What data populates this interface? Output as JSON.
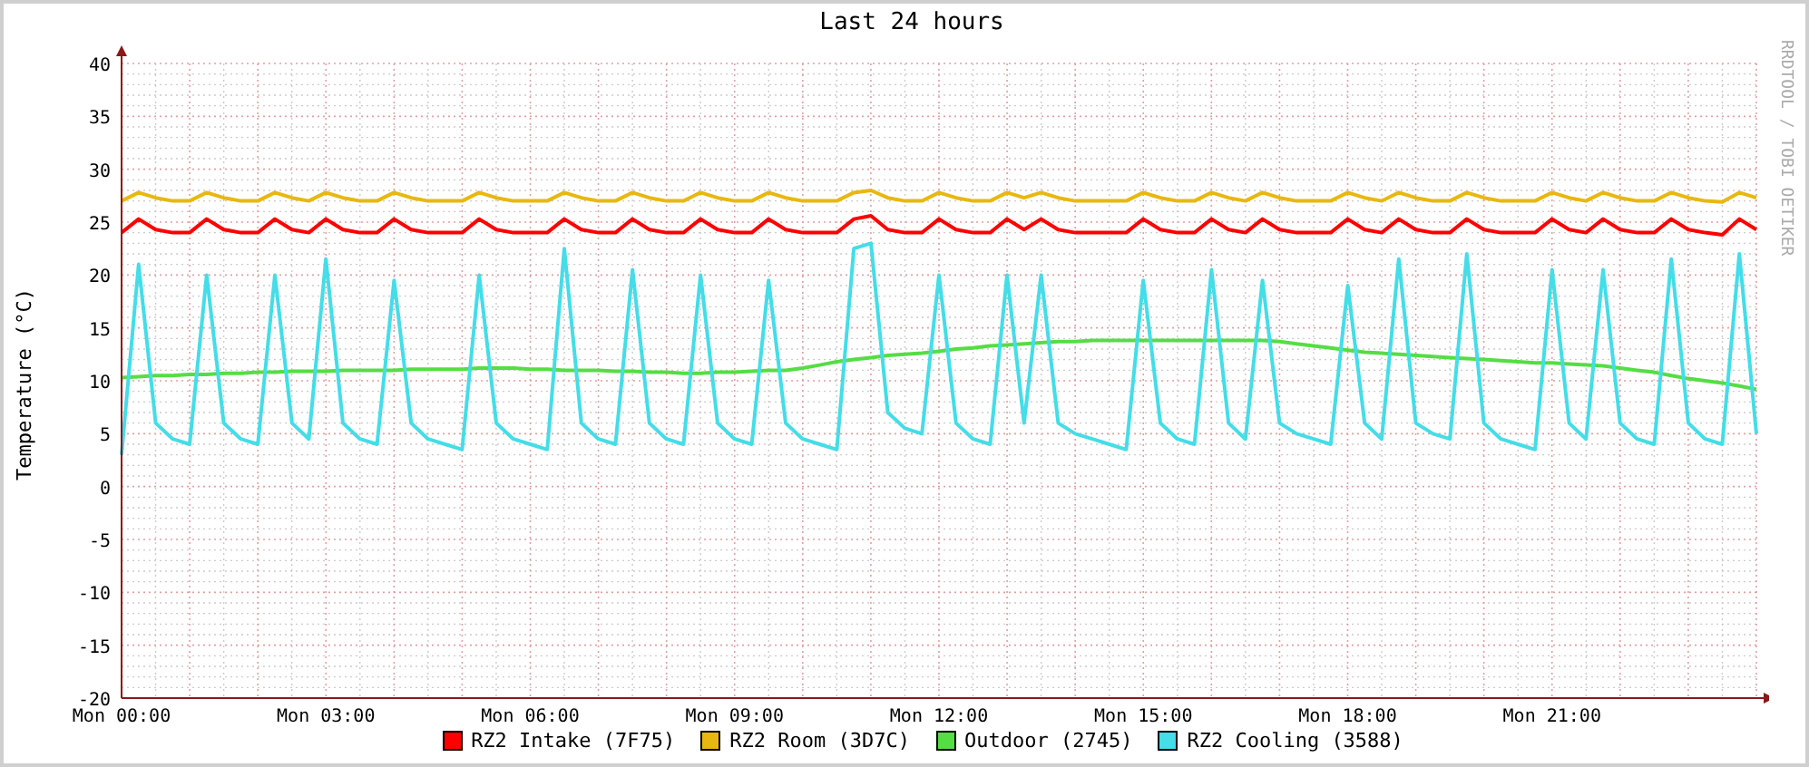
{
  "graph": {
    "credit": "RRDTOOL / TOBI OETIKER",
    "chart_data": {
      "type": "line",
      "title": "Last 24 hours",
      "ylabel": "Temperature (°C)",
      "ylim": [
        -20,
        40
      ],
      "grid": true,
      "yticks": [
        -20,
        -15,
        -10,
        -5,
        0,
        5,
        10,
        15,
        20,
        25,
        30,
        35,
        40
      ],
      "categories": [
        "Mon 00:00",
        null,
        null,
        null,
        null,
        null,
        null,
        null,
        null,
        null,
        null,
        null,
        "Mon 03:00",
        null,
        null,
        null,
        null,
        null,
        null,
        null,
        null,
        null,
        null,
        null,
        "Mon 06:00",
        null,
        null,
        null,
        null,
        null,
        null,
        null,
        null,
        null,
        null,
        null,
        "Mon 09:00",
        null,
        null,
        null,
        null,
        null,
        null,
        null,
        null,
        null,
        null,
        null,
        "Mon 12:00",
        null,
        null,
        null,
        null,
        null,
        null,
        null,
        null,
        null,
        null,
        null,
        "Mon 15:00",
        null,
        null,
        null,
        null,
        null,
        null,
        null,
        null,
        null,
        null,
        null,
        "Mon 18:00",
        null,
        null,
        null,
        null,
        null,
        null,
        null,
        null,
        null,
        null,
        null,
        "Mon 21:00",
        null,
        null,
        null,
        null,
        null,
        null,
        null,
        null,
        null,
        null,
        null,
        null
      ],
      "series": [
        {
          "name": "RZ2 Intake (7F75)",
          "color": "#ff0000",
          "values": [
            24,
            25.3,
            24.3,
            24,
            24,
            25.3,
            24.3,
            24,
            24,
            25.3,
            24.3,
            24,
            25.3,
            24.3,
            24,
            24,
            25.3,
            24.3,
            24,
            24,
            24,
            25.3,
            24.3,
            24,
            24,
            24,
            25.3,
            24.3,
            24,
            24,
            25.3,
            24.3,
            24,
            24,
            25.3,
            24.3,
            24,
            24,
            25.3,
            24.3,
            24,
            24,
            24,
            25.3,
            25.6,
            24.3,
            24,
            24,
            25.3,
            24.3,
            24,
            24,
            25.3,
            24.3,
            25.3,
            24.3,
            24,
            24,
            24,
            24,
            25.3,
            24.3,
            24,
            24,
            25.3,
            24.3,
            24,
            25.3,
            24.3,
            24,
            24,
            24,
            25.3,
            24.3,
            24,
            25.3,
            24.3,
            24,
            24,
            25.3,
            24.3,
            24,
            24,
            24,
            25.3,
            24.3,
            24,
            25.3,
            24.3,
            24,
            24,
            25.3,
            24.3,
            24,
            23.8,
            25.3,
            24.3
          ]
        },
        {
          "name": "RZ2 Room (3D7C)",
          "color": "#e8b810",
          "values": [
            27,
            27.8,
            27.3,
            27,
            27,
            27.8,
            27.3,
            27,
            27,
            27.8,
            27.3,
            27,
            27.8,
            27.3,
            27,
            27,
            27.8,
            27.3,
            27,
            27,
            27,
            27.8,
            27.3,
            27,
            27,
            27,
            27.8,
            27.3,
            27,
            27,
            27.8,
            27.3,
            27,
            27,
            27.8,
            27.3,
            27,
            27,
            27.8,
            27.3,
            27,
            27,
            27,
            27.8,
            28,
            27.3,
            27,
            27,
            27.8,
            27.3,
            27,
            27,
            27.8,
            27.3,
            27.8,
            27.3,
            27,
            27,
            27,
            27,
            27.8,
            27.3,
            27,
            27,
            27.8,
            27.3,
            27,
            27.8,
            27.3,
            27,
            27,
            27,
            27.8,
            27.3,
            27,
            27.8,
            27.3,
            27,
            27,
            27.8,
            27.3,
            27,
            27,
            27,
            27.8,
            27.3,
            27,
            27.8,
            27.3,
            27,
            27,
            27.8,
            27.3,
            27,
            26.9,
            27.8,
            27.3
          ]
        },
        {
          "name": "Outdoor (2745)",
          "color": "#55dd44",
          "values": [
            10.3,
            10.4,
            10.5,
            10.5,
            10.6,
            10.6,
            10.7,
            10.7,
            10.8,
            10.8,
            10.9,
            10.9,
            10.9,
            11,
            11,
            11,
            11,
            11.1,
            11.1,
            11.1,
            11.1,
            11.2,
            11.2,
            11.2,
            11.1,
            11.1,
            11,
            11,
            11,
            10.9,
            10.9,
            10.8,
            10.8,
            10.7,
            10.7,
            10.8,
            10.8,
            10.9,
            11,
            11,
            11.2,
            11.5,
            11.8,
            12,
            12.2,
            12.4,
            12.5,
            12.6,
            12.8,
            13,
            13.1,
            13.3,
            13.4,
            13.5,
            13.6,
            13.7,
            13.7,
            13.8,
            13.8,
            13.8,
            13.8,
            13.8,
            13.8,
            13.8,
            13.8,
            13.8,
            13.8,
            13.8,
            13.7,
            13.5,
            13.3,
            13.1,
            12.9,
            12.7,
            12.6,
            12.5,
            12.4,
            12.3,
            12.2,
            12.1,
            12,
            11.9,
            11.8,
            11.7,
            11.7,
            11.6,
            11.5,
            11.4,
            11.2,
            11,
            10.8,
            10.5,
            10.2,
            10,
            9.8,
            9.5,
            9.2
          ]
        },
        {
          "name": "RZ2 Cooling (3588)",
          "color": "#44dde8",
          "values": [
            3,
            21,
            6,
            4.5,
            4,
            20,
            6,
            4.5,
            4,
            20,
            6,
            4.5,
            21.5,
            6,
            4.5,
            4,
            19.5,
            6,
            4.5,
            4,
            3.5,
            20,
            6,
            4.5,
            4,
            3.5,
            22.5,
            6,
            4.5,
            4,
            20.5,
            6,
            4.5,
            4,
            20,
            6,
            4.5,
            4,
            19.5,
            6,
            4.5,
            4,
            3.5,
            22.5,
            23,
            7,
            5.5,
            5,
            20,
            6,
            4.5,
            4,
            20,
            6,
            20,
            6,
            5,
            4.5,
            4,
            3.5,
            19.5,
            6,
            4.5,
            4,
            20.5,
            6,
            4.5,
            19.5,
            6,
            5,
            4.5,
            4,
            19,
            6,
            4.5,
            21.5,
            6,
            5,
            4.5,
            22,
            6,
            4.5,
            4,
            3.5,
            20.5,
            6,
            4.5,
            20.5,
            6,
            4.5,
            4,
            21.5,
            6,
            4.5,
            4,
            22,
            5
          ]
        }
      ]
    }
  }
}
